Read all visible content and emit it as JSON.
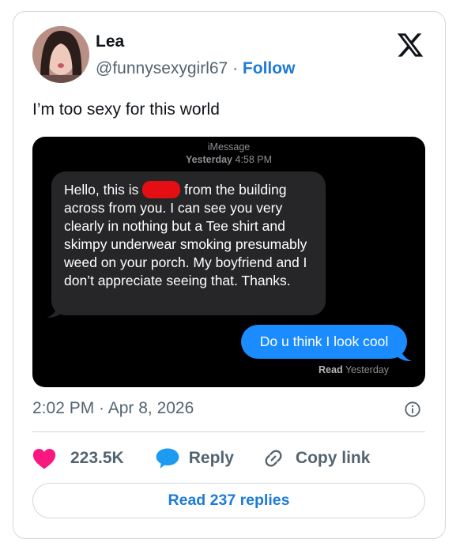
{
  "author": {
    "name": "Lea",
    "handle": "@funnysexygirl67",
    "separator": "·",
    "follow_label": "Follow"
  },
  "tweet": {
    "text": "I’m too sexy for this world"
  },
  "media": {
    "service": "iMessage",
    "day": "Yesterday",
    "time": "4:58 PM",
    "incoming_before": "Hello, this is",
    "incoming_after": "from the building across from you. I can see you very clearly in nothing but a Tee shirt and skimpy underwear smoking presumably weed on your porch. My boyfriend and I don’t appreciate seeing that. Thanks.",
    "outgoing": "Do u think I look cool",
    "read_label": "Read",
    "read_time": "Yesterday"
  },
  "meta": {
    "timestamp": "2:02 PM · Apr 8, 2026"
  },
  "actions": {
    "like_count": "223.5K",
    "reply_label": "Reply",
    "copy_label": "Copy link",
    "read_replies": "Read 237 replies"
  },
  "colors": {
    "accent": "#1d7bd6",
    "like": "#f91880",
    "imessage_blue": "#1a8cff",
    "imessage_gray": "#262628",
    "redaction": "#e30f13"
  },
  "icons": {
    "x_logo": "x-logo-icon",
    "info": "info-icon",
    "heart": "heart-icon",
    "reply": "speech-bubble-icon",
    "link": "link-icon"
  }
}
